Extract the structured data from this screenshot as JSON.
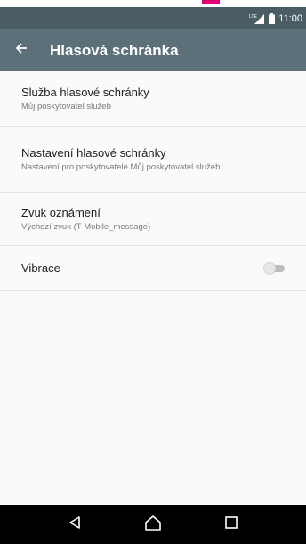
{
  "status_bar": {
    "time": "11:00",
    "network": "LTE"
  },
  "app_bar": {
    "title": "Hlasová schránka",
    "back_icon": "arrow-left-icon"
  },
  "settings": [
    {
      "title": "Služba hlasové schránky",
      "subtitle": "Můj poskytovatel služeb"
    },
    {
      "title": "Nastavení hlasové schránky",
      "subtitle": "Nastavení pro poskytovatele Můj poskytovatel služeb"
    },
    {
      "title": "Zvuk oznámení",
      "subtitle": "Výchozí zvuk (T-Mobile_message)"
    }
  ],
  "vibration": {
    "label": "Vibrace",
    "enabled": false
  },
  "nav_bar": {
    "back_icon": "triangle-back-icon",
    "home_icon": "home-icon",
    "recents_icon": "square-recents-icon"
  },
  "colors": {
    "status_bar": "#4b5d64",
    "app_bar": "#5b7078",
    "accent": "#e20074",
    "nav_bar": "#000000"
  }
}
